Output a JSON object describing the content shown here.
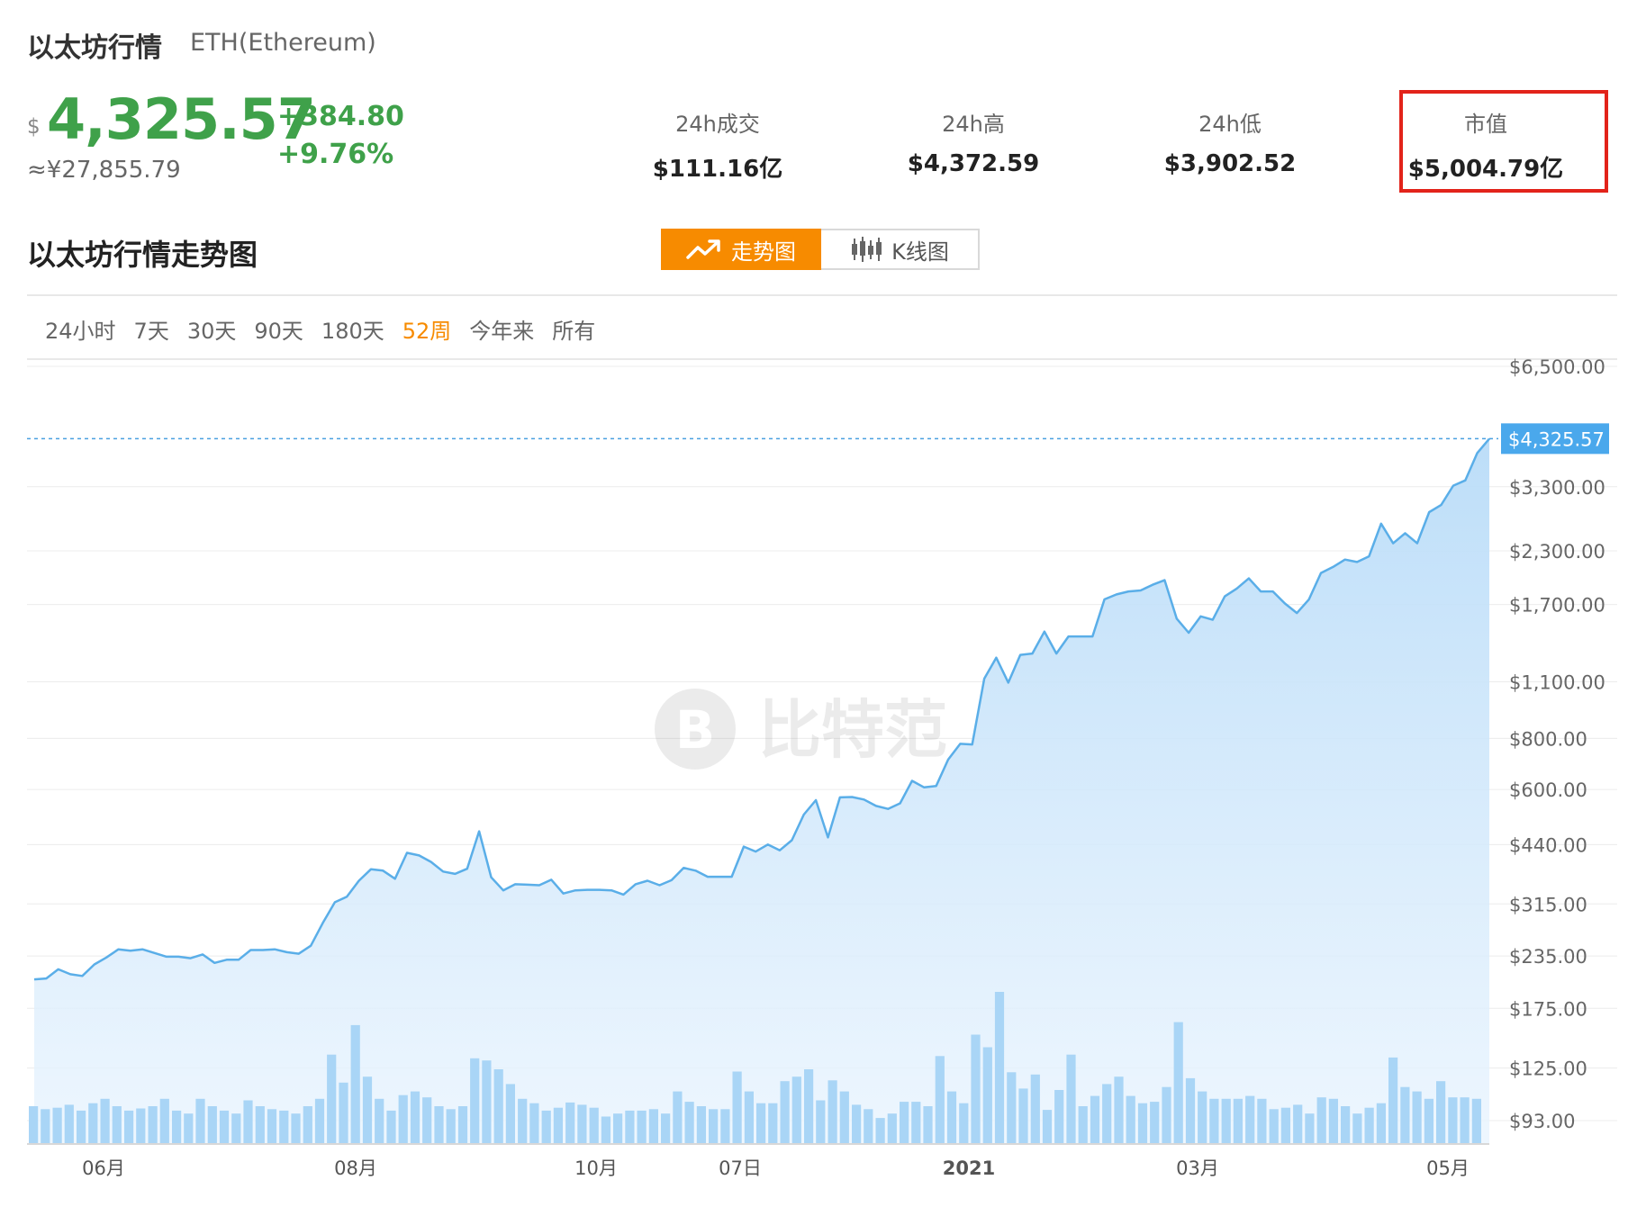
{
  "header": {
    "title": "以太坊行情",
    "symbol": "ETH(Ethereum)",
    "currency_symbol": "$",
    "price": "4,325.57",
    "change": "+384.80",
    "change_pct": "+9.76%",
    "price_cny": "≈¥27,855.79"
  },
  "stats": [
    {
      "label": "24h成交",
      "value": "$111.16亿"
    },
    {
      "label": "24h高",
      "value": "$4,372.59"
    },
    {
      "label": "24h低",
      "value": "$3,902.52"
    },
    {
      "label": "市值",
      "value": "$5,004.79亿"
    }
  ],
  "section_title": "以太坊行情走势图",
  "toggle": {
    "trend_label": "走势图",
    "kline_label": "K线图"
  },
  "ranges": [
    {
      "label": "24小时",
      "active": false
    },
    {
      "label": "7天",
      "active": false
    },
    {
      "label": "30天",
      "active": false
    },
    {
      "label": "90天",
      "active": false
    },
    {
      "label": "180天",
      "active": false
    },
    {
      "label": "52周",
      "active": true
    },
    {
      "label": "今年来",
      "active": false
    },
    {
      "label": "所有",
      "active": false
    }
  ],
  "watermark": "比特范",
  "colors": {
    "up": "#3fa14a",
    "accent": "#f78b00",
    "line": "#5aaee8",
    "area": "#cfe6fb",
    "volume": "#a9d5f6",
    "highlight_box": "#e2231a"
  },
  "chart_data": {
    "type": "area",
    "y_scale": "log",
    "y_ticks": [
      "$93.00",
      "$125.00",
      "$175.00",
      "$235.00",
      "$315.00",
      "$440.00",
      "$600.00",
      "$800.00",
      "$1,100.00",
      "$1,700.00",
      "$2,300.00",
      "$3,300.00",
      "$6,500.00"
    ],
    "y_tick_values": [
      93,
      125,
      175,
      235,
      315,
      440,
      600,
      800,
      1100,
      1700,
      2300,
      3300,
      6500
    ],
    "x_ticks": [
      "06月",
      "08月",
      "10月",
      "07日",
      "2021",
      "03月",
      "05月"
    ],
    "current_price_label": "$4,325.57",
    "current_price": 4325.57,
    "series": [
      {
        "values": [
          206,
          207,
          218,
          212,
          210,
          224,
          233,
          244,
          242,
          244,
          239,
          234,
          234,
          232,
          237,
          226,
          230,
          230,
          243,
          243,
          244,
          240,
          238,
          249,
          283,
          318,
          328,
          359,
          383,
          380,
          363,
          420,
          414,
          399,
          378,
          373,
          384,
          474,
          366,
          340,
          352,
          351,
          350,
          361,
          334,
          340,
          341,
          341,
          340,
          332,
          352,
          359,
          350,
          360,
          386,
          380,
          367,
          367,
          367,
          435,
          423,
          440,
          426,
          451,
          521,
          565,
          458,
          574,
          575,
          567,
          547,
          538,
          555,
          630,
          607,
          612,
          710,
          776,
          773,
          1120,
          1260,
          1095,
          1280,
          1290,
          1460,
          1290,
          1420,
          1420,
          1420,
          1750,
          1800,
          1830,
          1840,
          1900,
          1950,
          1570,
          1450,
          1590,
          1560,
          1780,
          1860,
          1970,
          1830,
          1830,
          1710,
          1620,
          1750,
          2030,
          2100,
          2190,
          2160,
          2230,
          2680,
          2400,
          2540,
          2400,
          2860,
          2980,
          3320,
          3420,
          3990,
          4325.57
        ]
      }
    ],
    "volume": [
      50,
      46,
      48,
      52,
      44,
      54,
      60,
      50,
      44,
      47,
      50,
      60,
      44,
      40,
      60,
      50,
      44,
      40,
      58,
      50,
      46,
      44,
      40,
      50,
      60,
      120,
      82,
      160,
      90,
      60,
      44,
      65,
      70,
      62,
      50,
      46,
      50,
      115,
      112,
      100,
      80,
      60,
      54,
      44,
      48,
      55,
      52,
      48,
      36,
      40,
      44,
      44,
      46,
      40,
      70,
      56,
      50,
      46,
      46,
      97,
      70,
      54,
      54,
      84,
      90,
      100,
      58,
      85,
      70,
      52,
      46,
      34,
      40,
      56,
      56,
      50,
      118,
      70,
      54,
      147,
      130,
      205,
      96,
      74,
      93,
      45,
      72,
      120,
      50,
      64,
      80,
      90,
      64,
      54,
      56,
      76,
      164,
      88,
      70,
      60,
      60,
      60,
      64,
      60,
      46,
      48,
      52,
      40,
      62,
      60,
      50,
      40,
      48,
      54,
      116,
      76,
      70,
      60,
      84,
      62,
      62,
      60
    ]
  }
}
